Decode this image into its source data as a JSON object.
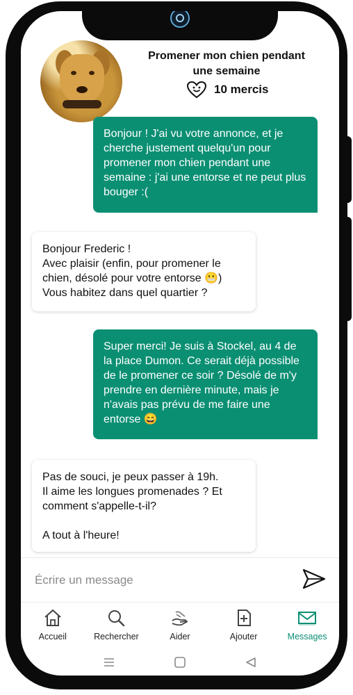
{
  "header": {
    "title": "Promener mon chien pendant une semaine",
    "thanks_count": "10 mercis"
  },
  "messages": [
    {
      "from": "me",
      "text": "Bonjour ! J'ai vu votre annonce, et je cherche justement quelqu'un pour promener mon chien pendant une semaine : j'ai une entorse et ne peut plus bouger :("
    },
    {
      "from": "them",
      "text": "Bonjour Frederic !\nAvec plaisir (enfin, pour promener le chien, désolé pour votre entorse 😬)\nVous habitez dans quel quartier ?"
    },
    {
      "from": "me",
      "text": "Super merci!   Je suis à Stockel, au 4 de la place Dumon.  Ce serait déjà possible de le promener ce soir ?  Désolé de m'y prendre en dernière minute, mais je n'avais pas prévu de me faire une entorse 😄"
    },
    {
      "from": "them",
      "text": "Pas de souci, je peux passer à 19h.\nIl aime les longues promenades ?  Et comment s'appelle-t-il?\n\nA tout à l'heure!"
    }
  ],
  "composer": {
    "placeholder": "Écrire un message"
  },
  "nav": [
    {
      "label": "Accueil",
      "icon": "home-icon"
    },
    {
      "label": "Rechercher",
      "icon": "search-icon"
    },
    {
      "label": "Aider",
      "icon": "helping-hand-icon"
    },
    {
      "label": "Ajouter",
      "icon": "add-document-icon"
    },
    {
      "label": "Messages",
      "icon": "envelope-icon",
      "active": true
    }
  ],
  "colors": {
    "accent": "#0b8f73",
    "outgoing_bubble": "#0b8f73",
    "incoming_bubble": "#ffffff"
  }
}
